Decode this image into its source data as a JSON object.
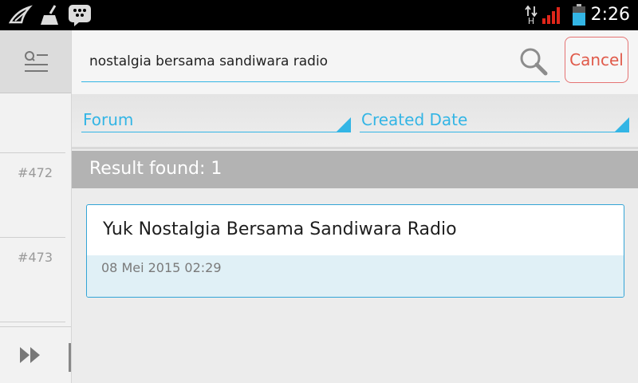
{
  "status_bar": {
    "time": "2:26",
    "network_label": "H",
    "battery_color": "#33b5e5",
    "signal_color": "#e0261a",
    "icons": [
      "sword-icon",
      "broom-icon",
      "bbm-icon",
      "data-arrows-icon",
      "signal-icon",
      "battery-icon"
    ]
  },
  "sidebar": {
    "items": [
      {
        "number": "#472"
      },
      {
        "number": "#473"
      }
    ],
    "menu_icon": "search-list-icon",
    "footer_icon": "fast-forward-icon"
  },
  "search": {
    "query": "nostalgia bersama sandiwara radio",
    "cancel_label": "Cancel"
  },
  "filters": {
    "forum_label": "Forum",
    "date_label": "Created Date"
  },
  "results": {
    "summary": "Result found: 1",
    "items": [
      {
        "title": "Yuk Nostalgia Bersama Sandiwara Radio",
        "date": "08 Mei 2015 02:29"
      }
    ]
  },
  "colors": {
    "accent": "#33b5e5",
    "cancel": "#e05a4a",
    "result_bar": "#b3b3b3"
  }
}
